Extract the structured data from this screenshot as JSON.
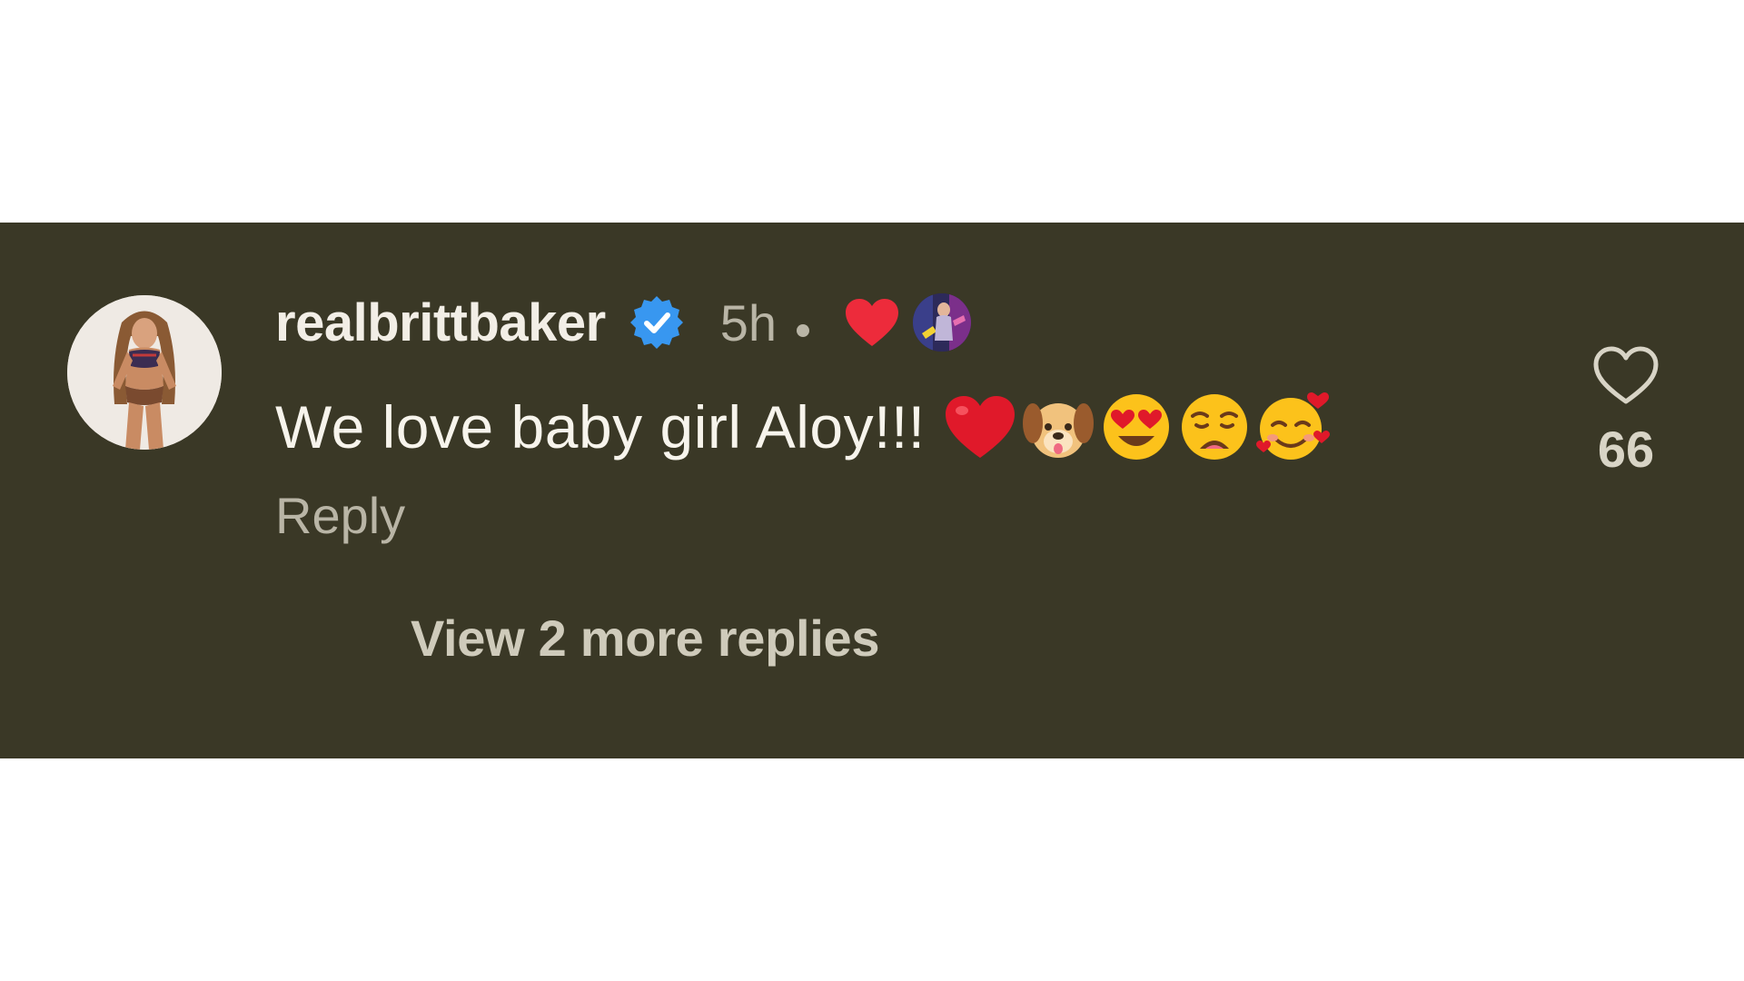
{
  "comment": {
    "username": "realbrittbaker",
    "verified": true,
    "timestamp": "5h",
    "text": "We love baby girl Aloy!!!",
    "emojis": [
      "red-heart",
      "dog-face",
      "heart-eyes-face",
      "weary-face",
      "smiling-face-with-hearts"
    ],
    "reply_label": "Reply",
    "like_count": "66",
    "view_replies_label": "View 2 more replies",
    "liked_by_author": true
  },
  "colors": {
    "background_band": "#3a3826",
    "page_background": "#ffffff",
    "username": "#f2eee6",
    "secondary_text": "#b9b5a6",
    "verified_badge": "#3897f0",
    "liked_heart": "#ed2b3b"
  }
}
